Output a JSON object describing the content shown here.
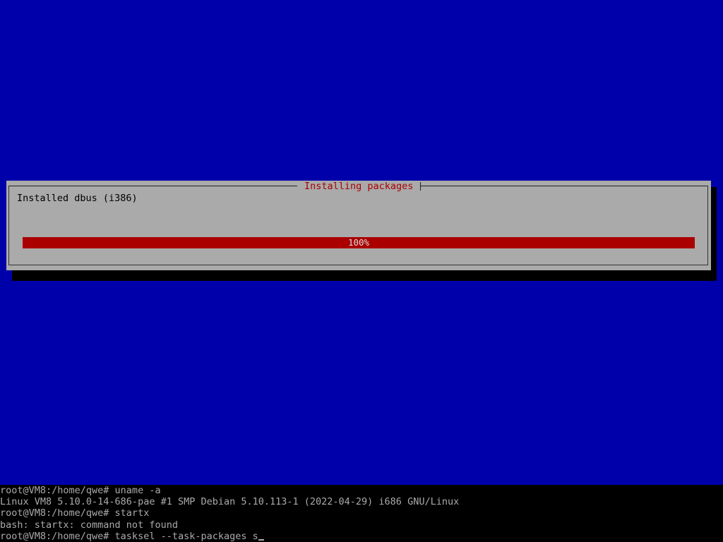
{
  "colors": {
    "background": "#0000aa",
    "dialog": "#aaaaaa",
    "accent": "#aa0000",
    "terminal_bg": "#000000",
    "terminal_fg": "#aaaaaa"
  },
  "dialog": {
    "title": "Installing packages",
    "status": "Installed dbus (i386)",
    "progress": {
      "percent": 100,
      "label": "100%"
    }
  },
  "terminal": {
    "lines": [
      "root@VM8:/home/qwe# uname -a",
      "Linux VM8 5.10.0-14-686-pae #1 SMP Debian 5.10.113-1 (2022-04-29) i686 GNU/Linux",
      "root@VM8:/home/qwe# startx",
      "bash: startx: command not found",
      "root@VM8:/home/qwe# tasksel --task-packages s"
    ],
    "cursor_icon": "block-cursor-icon"
  }
}
